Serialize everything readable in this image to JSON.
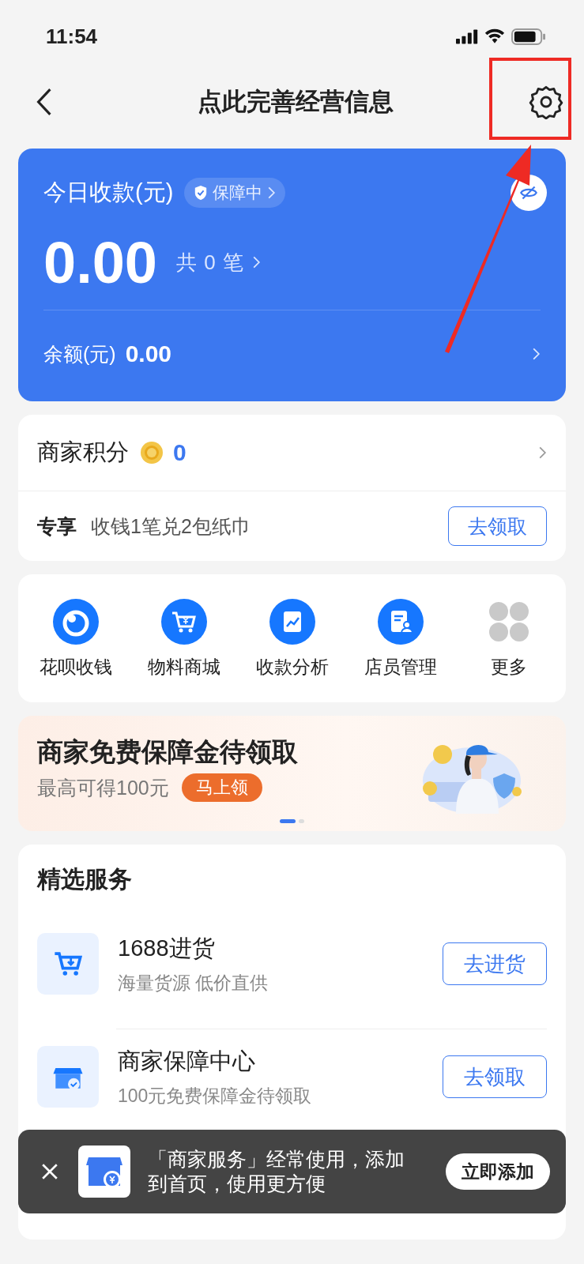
{
  "status_bar": {
    "time": "11:54"
  },
  "nav": {
    "title": "点此完善经营信息"
  },
  "summary": {
    "title": "今日收款(元)",
    "badge": "保障中",
    "amount": "0.00",
    "count": "共 0 笔",
    "balance_label": "余额(元)",
    "balance": "0.00"
  },
  "points": {
    "label": "商家积分",
    "value": "0",
    "promo_tag": "专享",
    "promo_text": "收钱1笔兑2包纸巾",
    "button": "去领取"
  },
  "shortcuts": [
    {
      "kind": "huabei",
      "label": "花呗收钱"
    },
    {
      "kind": "cart",
      "label": "物料商城"
    },
    {
      "kind": "chart",
      "label": "收款分析"
    },
    {
      "kind": "staff",
      "label": "店员管理"
    },
    {
      "kind": "more",
      "label": "更多"
    }
  ],
  "banner": {
    "title": "商家免费保障金待领取",
    "subtitle": "最高可得100元",
    "button": "马上领",
    "pages": [
      {
        "selected": true
      },
      {
        "selected": false
      }
    ]
  },
  "services": {
    "title": "精选服务",
    "items": [
      {
        "kind": "cart",
        "title": "1688进货",
        "subtitle": "海量货源 低价直供",
        "button": "去进货"
      },
      {
        "kind": "shop",
        "title": "商家保障中心",
        "subtitle": "100元免费保障金待领取",
        "button": "去领取"
      }
    ]
  },
  "toast": {
    "message": "「商家服务」经常使用，添加到首页，使用更方便",
    "button": "立即添加"
  }
}
